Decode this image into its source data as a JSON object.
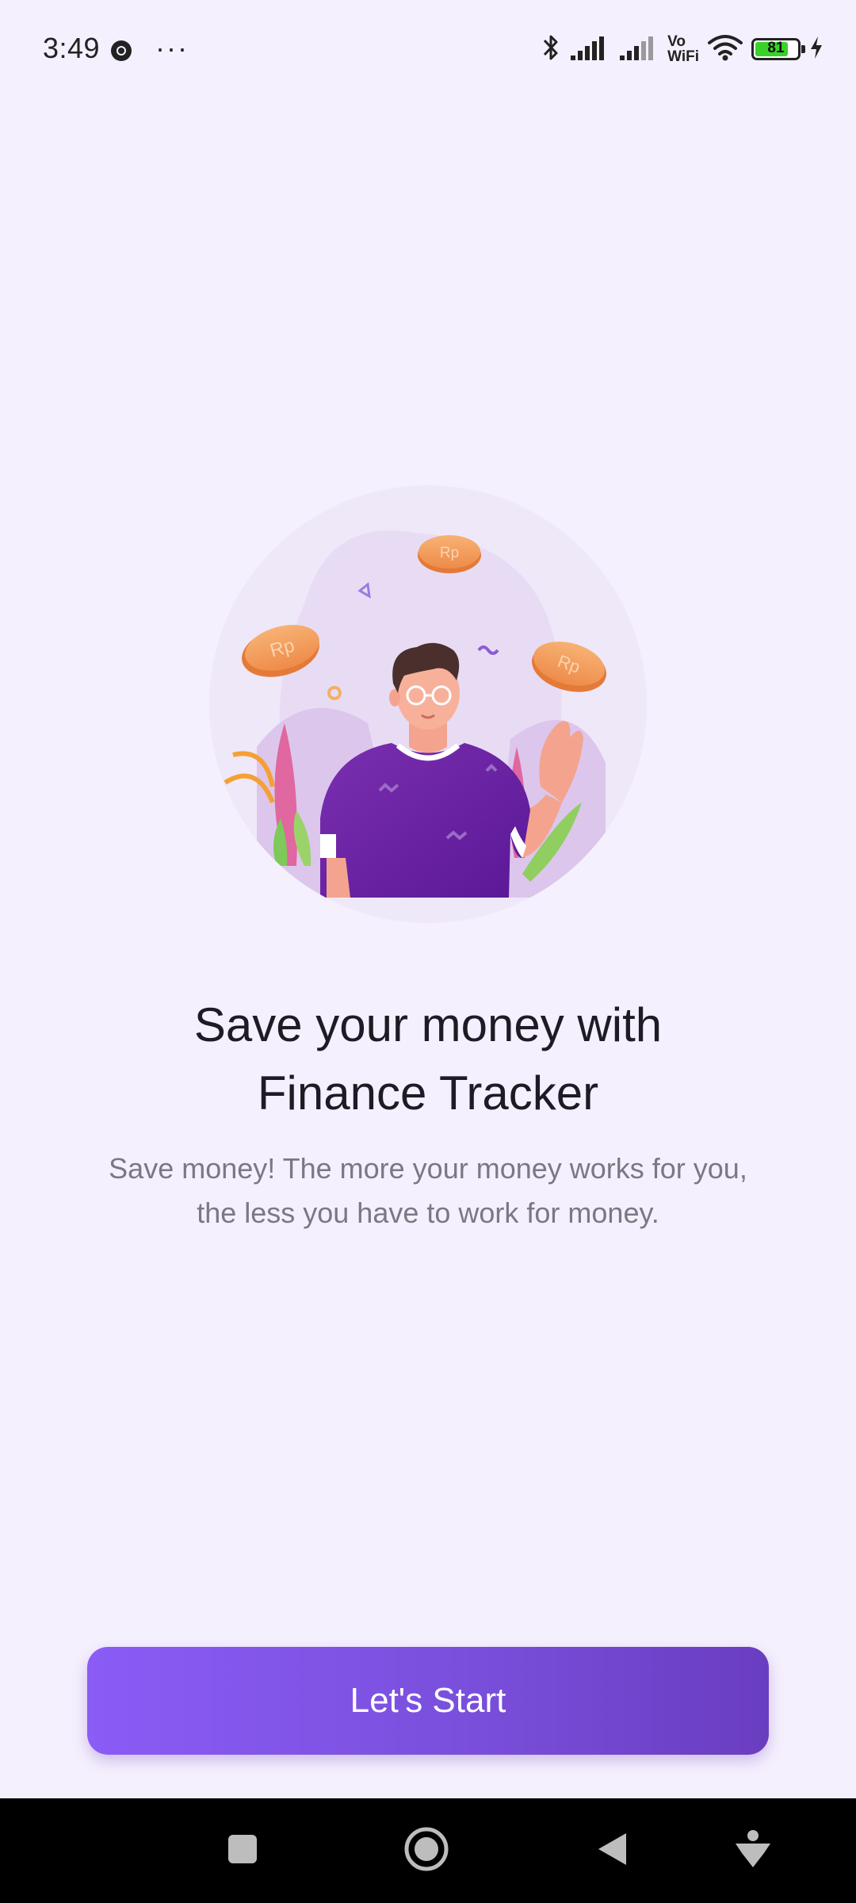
{
  "status_bar": {
    "time": "3:49",
    "more": "···",
    "vowifi_top": "Vo",
    "vowifi_bottom": "WiFi",
    "battery_level": "81",
    "battery_fraction": 0.81,
    "icons": [
      "chrome-icon",
      "bluetooth-icon",
      "signal-icon",
      "signal-icon",
      "wifi-icon",
      "battery-icon",
      "charging-icon"
    ]
  },
  "onboarding": {
    "coin_label": "Rp",
    "title_line1": "Save your money with",
    "title_line2": "Finance Tracker",
    "subtitle_line1": "Save money! The more your money works for you,",
    "subtitle_line2": "the less you have to work for money.",
    "start_button": "Let's Start"
  },
  "colors": {
    "background": "#f5f0fd",
    "accent": "#7c4ddf",
    "title": "#1e1b24",
    "subtitle": "#7b7882"
  },
  "nav_bar": {
    "icons": [
      "recents-icon",
      "home-icon",
      "back-icon",
      "accessibility-icon"
    ]
  }
}
